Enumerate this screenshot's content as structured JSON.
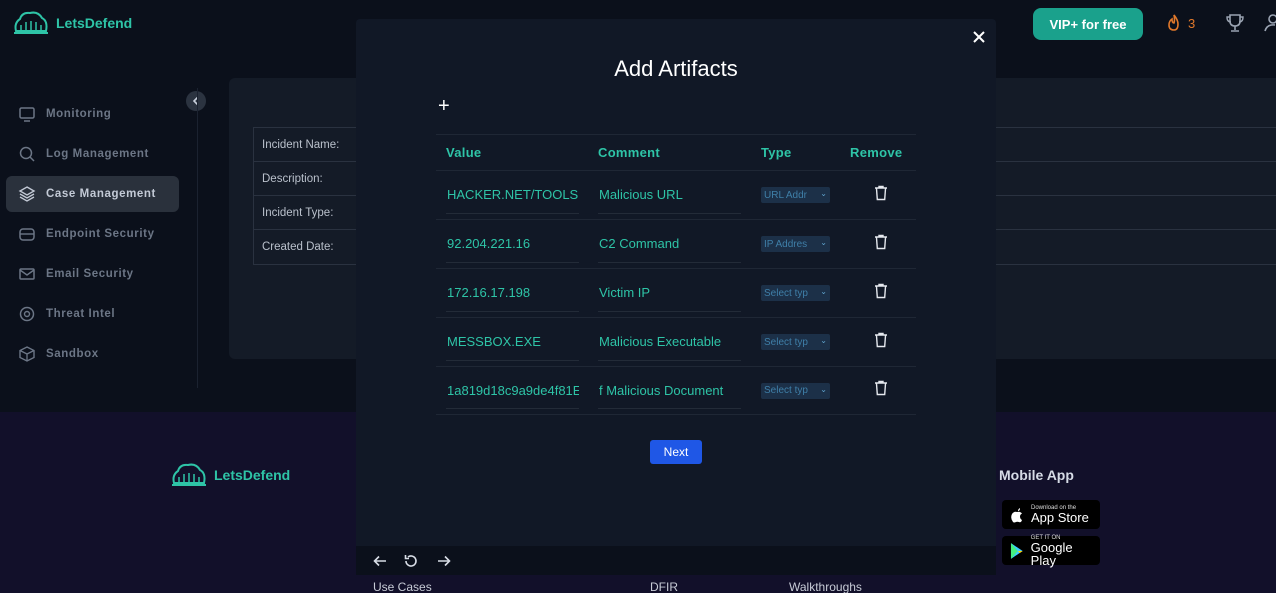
{
  "brand": {
    "name": "LetsDefend"
  },
  "header": {
    "title_partial": "",
    "vip_label": "VIP+ for free",
    "streak_count": "3"
  },
  "sidebar": {
    "items": [
      {
        "label": "Monitoring",
        "icon": "monitor-icon"
      },
      {
        "label": "Log Management",
        "icon": "search-icon"
      },
      {
        "label": "Case Management",
        "icon": "layers-icon",
        "active": true
      },
      {
        "label": "Endpoint Security",
        "icon": "server-icon"
      },
      {
        "label": "Email Security",
        "icon": "mail-icon"
      },
      {
        "label": "Threat Intel",
        "icon": "crosshair-icon"
      },
      {
        "label": "Sandbox",
        "icon": "cube-icon"
      }
    ]
  },
  "case_form": {
    "rows": [
      {
        "label": "Incident Name:"
      },
      {
        "label": "Description:"
      },
      {
        "label": "Incident Type:"
      },
      {
        "label": "Created Date:"
      }
    ]
  },
  "modal": {
    "title": "Add Artifacts",
    "add_symbol": "+",
    "columns": {
      "value": "Value",
      "comment": "Comment",
      "type": "Type",
      "remove": "Remove"
    },
    "rows": [
      {
        "value": "HACKER.NET/TOOLS",
        "comment": "Malicious URL",
        "type": "URL Addr"
      },
      {
        "value": "92.204.221.16",
        "comment": "C2 Command",
        "type": "IP Addres"
      },
      {
        "value": "172.16.17.198",
        "comment": "Victim IP",
        "type": "Select typ"
      },
      {
        "value": "MESSBOX.EXE",
        "comment": "Malicious Executable",
        "type": "Select typ"
      },
      {
        "value": "1a819d18c9a9de4f81E",
        "comment": "f Malicious Document",
        "type": "Select typ"
      }
    ],
    "next_label": "Next"
  },
  "footer": {
    "mobile_title": "Mobile App",
    "app_store": {
      "small": "Download on the",
      "big": "App Store"
    },
    "google_play": {
      "small": "GET IT ON",
      "big": "Google Play"
    },
    "links": [
      "Use Cases",
      "DFIR",
      "Walkthroughs"
    ]
  },
  "colors": {
    "accent": "#2ec4a7",
    "primary_button": "#1f57e6",
    "vip": "#1aa18c",
    "streak": "#e0782b"
  }
}
